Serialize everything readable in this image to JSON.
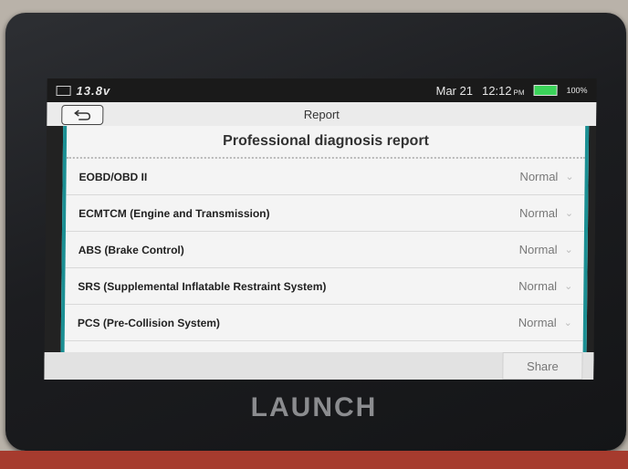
{
  "status_bar": {
    "voltage": "13.8v",
    "date": "Mar 21",
    "time": "12:12",
    "ampm": "PM",
    "battery": "100%"
  },
  "title_bar": {
    "title": "Report"
  },
  "report": {
    "heading": "Professional diagnosis report",
    "rows": [
      {
        "system": "EOBD/OBD II",
        "status": "Normal"
      },
      {
        "system": "ECMTCM (Engine and Transmission)",
        "status": "Normal"
      },
      {
        "system": "ABS (Brake Control)",
        "status": "Normal"
      },
      {
        "system": "SRS (Supplemental Inflatable Restraint System)",
        "status": "Normal"
      },
      {
        "system": "PCS (Pre-Collision System)",
        "status": "Normal"
      }
    ]
  },
  "footer": {
    "share_label": "Share"
  },
  "device": {
    "brand": "LAUNCH"
  },
  "colors": {
    "accent": "#1b8f93",
    "battery": "#3bd45a"
  }
}
